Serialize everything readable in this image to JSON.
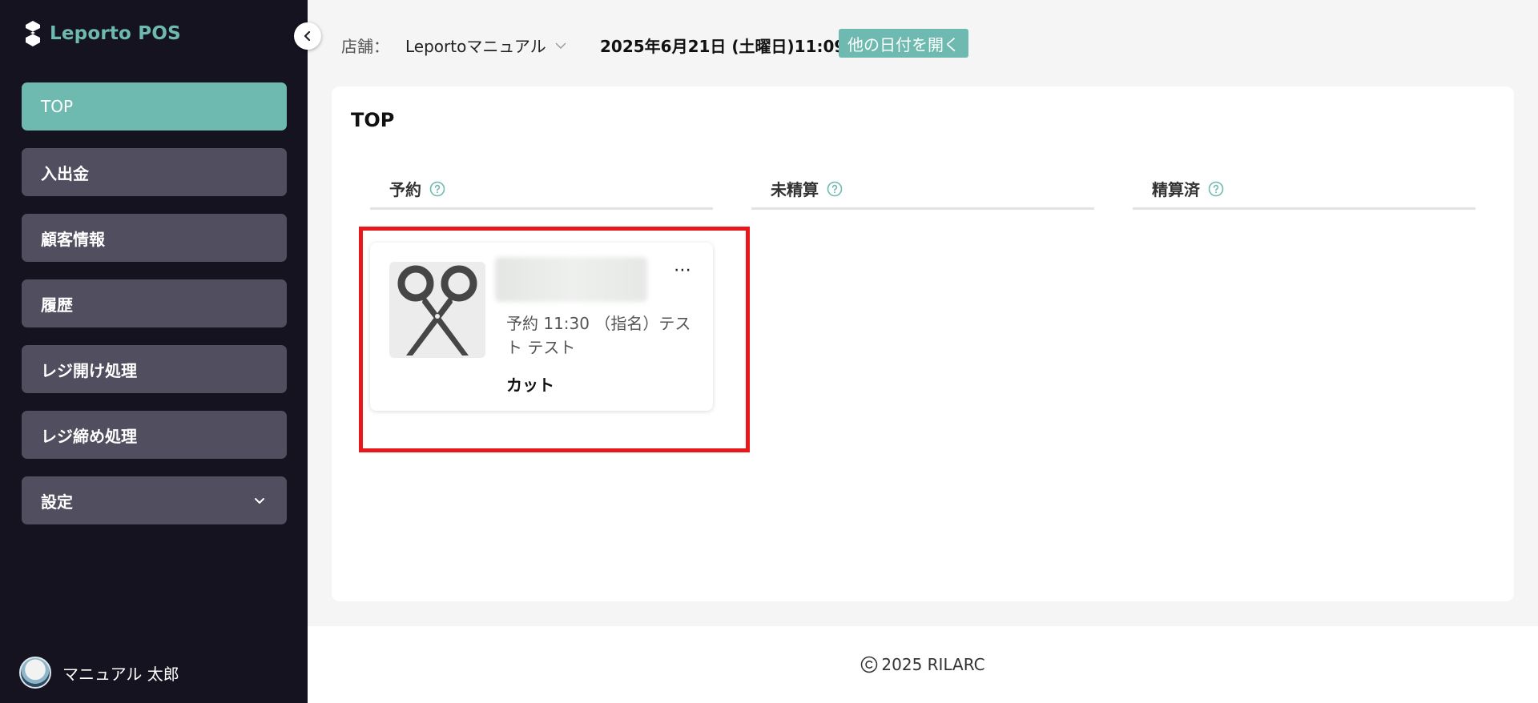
{
  "app": {
    "name": "Leporto POS"
  },
  "sidebar": {
    "items": [
      {
        "label": "TOP",
        "active": true
      },
      {
        "label": "入出金"
      },
      {
        "label": "顧客情報"
      },
      {
        "label": "履歴"
      },
      {
        "label": "レジ開け処理"
      },
      {
        "label": "レジ締め処理"
      },
      {
        "label": "設定",
        "has_submenu": true
      }
    ],
    "user_name": "マニュアル 太郎"
  },
  "header": {
    "store_label": "店舗：",
    "store_value": "Leportoマニュアル",
    "date": "2025年6月21日 (土曜日)11:09",
    "open_date_button": "他の日付を開く"
  },
  "main": {
    "title": "TOP",
    "columns": [
      {
        "label": "予約"
      },
      {
        "label": "未精算"
      },
      {
        "label": "精算済"
      }
    ],
    "reservation": {
      "info": "予約 11:30 （指名）テスト テスト",
      "menu": "カット",
      "more_label": "⋯"
    }
  },
  "footer": {
    "copyright": "2025 RILARC"
  },
  "colors": {
    "accent": "#6fbab0",
    "sidebar_bg": "#14131f",
    "nav_item_bg": "#514e60",
    "highlight": "#e8181b"
  },
  "icons": {
    "brand": "leporto-logo-icon",
    "collapse": "chevron-left-icon",
    "dropdown": "chevron-down-icon",
    "help": "question-circle-icon",
    "thumb": "scissors-icon",
    "copyright": "copyright-icon"
  }
}
